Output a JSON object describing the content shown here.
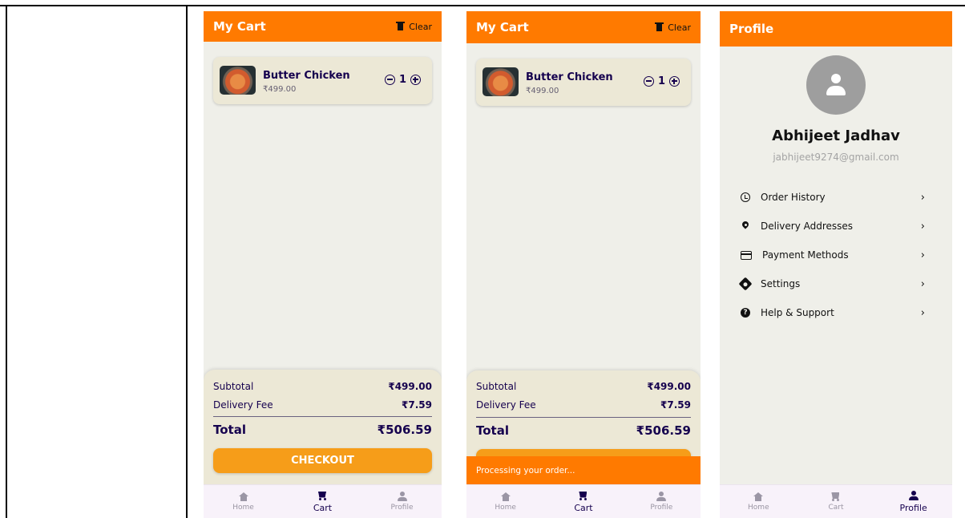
{
  "cart": {
    "title": "My Cart",
    "clear_label": "Clear",
    "item_name": "Butter Chicken",
    "item_price": "₹499.00",
    "qty": "1",
    "subtotal_label": "Subtotal",
    "subtotal_value": "₹499.00",
    "delivery_label": "Delivery Fee",
    "delivery_value": "₹7.59",
    "total_label": "Total",
    "total_value": "₹506.59",
    "checkout_label": "CHECKOUT",
    "snackbar": "Processing your order..."
  },
  "profile": {
    "title": "Profile",
    "name": "Abhijeet Jadhav",
    "email": "jabhijeet9274@gmail.com",
    "menu": [
      {
        "label": "Order History",
        "icon": "history-icon"
      },
      {
        "label": "Delivery Addresses",
        "icon": "location-pin-icon"
      },
      {
        "label": "Payment Methods",
        "icon": "credit-card-icon"
      },
      {
        "label": "Settings",
        "icon": "gear-icon"
      },
      {
        "label": "Help & Support",
        "icon": "help-icon"
      }
    ]
  },
  "nav": {
    "home": "Home",
    "cart": "Cart",
    "profile": "Profile"
  },
  "colors": {
    "brand_orange": "#ff7a00",
    "checkout_orange": "#f69d19",
    "dark_text": "#15004e",
    "card_bg": "#ece8d6",
    "nav_bg": "#f8f2fa"
  }
}
